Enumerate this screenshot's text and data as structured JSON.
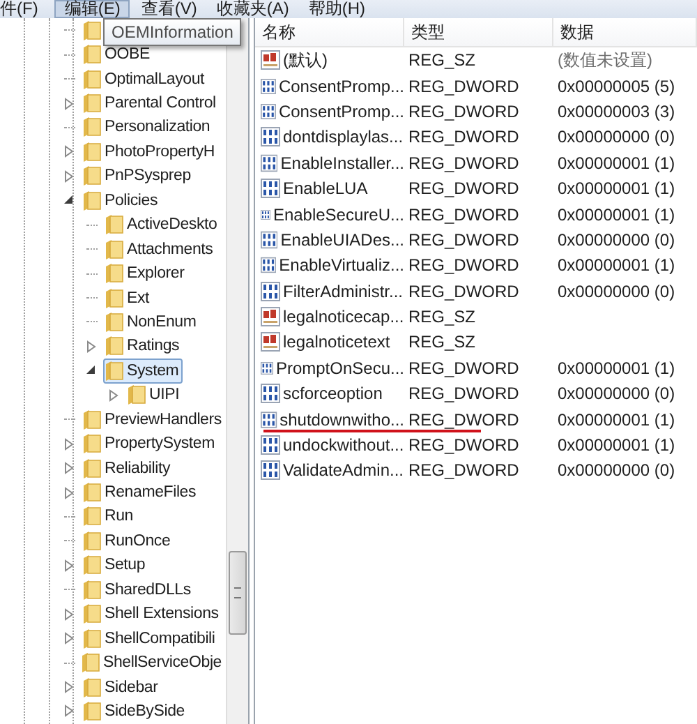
{
  "menu": [
    {
      "label": "件(F)",
      "selected": false
    },
    {
      "label": "编辑(E)",
      "selected": true
    },
    {
      "label": "查看(V)",
      "selected": false
    },
    {
      "label": "收藏夹(A)",
      "selected": false
    },
    {
      "label": "帮助(H)",
      "selected": false
    }
  ],
  "tooltip": "OEMInformation",
  "tree": [
    {
      "expandable": false,
      "selected": false
    },
    {
      "label": "OOBE",
      "expandable": false,
      "selected": false
    },
    {
      "label": "OptimalLayout",
      "expandable": false,
      "selected": false
    },
    {
      "label": "Parental Control",
      "expandable": true,
      "expanded": false,
      "selected": false
    },
    {
      "label": "Personalization",
      "expandable": false,
      "selected": false
    },
    {
      "label": "PhotoPropertyH",
      "expandable": true,
      "expanded": false,
      "selected": false
    },
    {
      "label": "PnPSysprep",
      "expandable": true,
      "expanded": false,
      "selected": false
    },
    {
      "label": "Policies",
      "expandable": true,
      "expanded": true,
      "selected": false,
      "children": [
        {
          "label": "ActiveDeskto",
          "expandable": false,
          "selected": false
        },
        {
          "label": "Attachments",
          "expandable": false,
          "selected": false
        },
        {
          "label": "Explorer",
          "expandable": false,
          "selected": false
        },
        {
          "label": "Ext",
          "expandable": false,
          "selected": false
        },
        {
          "label": "NonEnum",
          "expandable": false,
          "selected": false
        },
        {
          "label": "Ratings",
          "expandable": true,
          "expanded": false,
          "selected": false
        },
        {
          "label": "System",
          "expandable": true,
          "expanded": true,
          "selected": true,
          "children": [
            {
              "label": "UIPI",
              "expandable": true,
              "expanded": false,
              "selected": false
            }
          ]
        }
      ]
    },
    {
      "label": "PreviewHandlers",
      "expandable": false,
      "selected": false
    },
    {
      "label": "PropertySystem",
      "expandable": true,
      "expanded": false,
      "selected": false
    },
    {
      "label": "Reliability",
      "expandable": true,
      "expanded": false,
      "selected": false
    },
    {
      "label": "RenameFiles",
      "expandable": true,
      "expanded": false,
      "selected": false
    },
    {
      "label": "Run",
      "expandable": false,
      "selected": false
    },
    {
      "label": "RunOnce",
      "expandable": false,
      "selected": false
    },
    {
      "label": "Setup",
      "expandable": true,
      "expanded": false,
      "selected": false
    },
    {
      "label": "SharedDLLs",
      "expandable": false,
      "selected": false
    },
    {
      "label": "Shell Extensions",
      "expandable": true,
      "expanded": false,
      "selected": false
    },
    {
      "label": "ShellCompatibili",
      "expandable": true,
      "expanded": false,
      "selected": false
    },
    {
      "label": "ShellServiceObje",
      "expandable": false,
      "selected": false
    },
    {
      "label": "Sidebar",
      "expandable": true,
      "expanded": false,
      "selected": false
    },
    {
      "label": "SideBySide",
      "expandable": true,
      "expanded": false,
      "selected": false
    }
  ],
  "columns": [
    "名称",
    "类型",
    "数据"
  ],
  "values": [
    {
      "kind": "string",
      "name": "(默认)",
      "type": "REG_SZ",
      "data": "(数值未设置)",
      "underlined": false
    },
    {
      "kind": "dword",
      "name": "ConsentPromp...",
      "type": "REG_DWORD",
      "data": "0x00000005 (5)",
      "underlined": false
    },
    {
      "kind": "dword",
      "name": "ConsentPromp...",
      "type": "REG_DWORD",
      "data": "0x00000003 (3)",
      "underlined": false
    },
    {
      "kind": "dword",
      "name": "dontdisplaylas...",
      "type": "REG_DWORD",
      "data": "0x00000000 (0)",
      "underlined": false
    },
    {
      "kind": "dword",
      "name": "EnableInstaller...",
      "type": "REG_DWORD",
      "data": "0x00000001 (1)",
      "underlined": false
    },
    {
      "kind": "dword",
      "name": "EnableLUA",
      "type": "REG_DWORD",
      "data": "0x00000001 (1)",
      "underlined": false
    },
    {
      "kind": "dword",
      "name": "EnableSecureU...",
      "type": "REG_DWORD",
      "data": "0x00000001 (1)",
      "underlined": false
    },
    {
      "kind": "dword",
      "name": "EnableUIADes...",
      "type": "REG_DWORD",
      "data": "0x00000000 (0)",
      "underlined": false
    },
    {
      "kind": "dword",
      "name": "EnableVirtualiz...",
      "type": "REG_DWORD",
      "data": "0x00000001 (1)",
      "underlined": false
    },
    {
      "kind": "dword",
      "name": "FilterAdministr...",
      "type": "REG_DWORD",
      "data": "0x00000000 (0)",
      "underlined": false
    },
    {
      "kind": "string",
      "name": "legalnoticecap...",
      "type": "REG_SZ",
      "underlined": false
    },
    {
      "kind": "string",
      "name": "legalnoticetext",
      "type": "REG_SZ",
      "underlined": false
    },
    {
      "kind": "dword",
      "name": "PromptOnSecu...",
      "type": "REG_DWORD",
      "data": "0x00000001 (1)",
      "underlined": false
    },
    {
      "kind": "dword",
      "name": "scforceoption",
      "type": "REG_DWORD",
      "data": "0x00000000 (0)",
      "underlined": false
    },
    {
      "kind": "dword",
      "name": "shutdownwitho...",
      "type": "REG_DWORD",
      "data": "0x00000001 (1)",
      "underlined": true
    },
    {
      "kind": "dword",
      "name": "undockwithout...",
      "type": "REG_DWORD",
      "data": "0x00000001 (1)",
      "underlined": false
    },
    {
      "kind": "dword",
      "name": "ValidateAdmin...",
      "type": "REG_DWORD",
      "data": "0x00000000 (0)",
      "underlined": false
    }
  ]
}
